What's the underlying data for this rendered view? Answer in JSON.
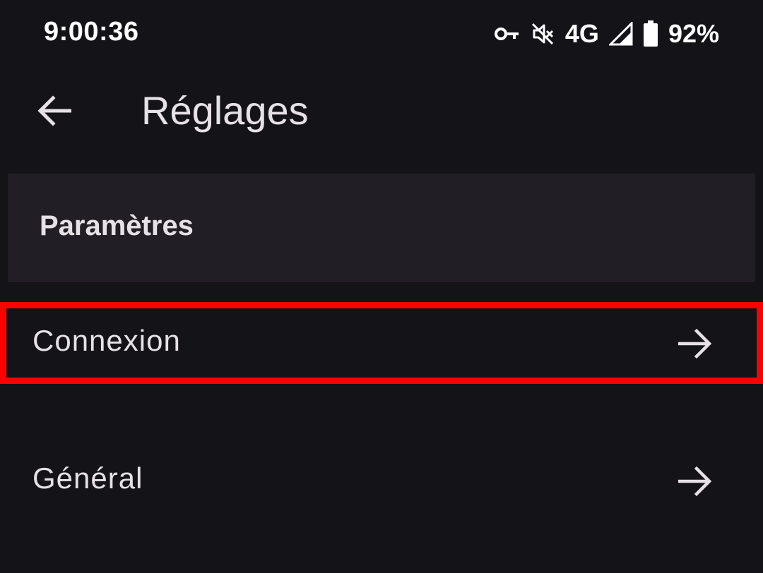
{
  "status_bar": {
    "time": "9:00:36",
    "network": "4G",
    "battery": "92%",
    "icons": [
      "vpn-key-icon",
      "mute-icon",
      "signal-icon",
      "battery-icon"
    ]
  },
  "app_bar": {
    "title": "Réglages",
    "back_icon": "arrow-back-icon"
  },
  "section": {
    "title": "Paramètres"
  },
  "menu": {
    "items": [
      {
        "label": "Connexion",
        "icon": "arrow-forward-icon"
      },
      {
        "label": "Général",
        "icon": "arrow-forward-icon"
      }
    ]
  },
  "colors": {
    "background": "#141318",
    "section_bg": "#211f25",
    "text": "#e6e1e6",
    "highlight": "#ff0000"
  }
}
